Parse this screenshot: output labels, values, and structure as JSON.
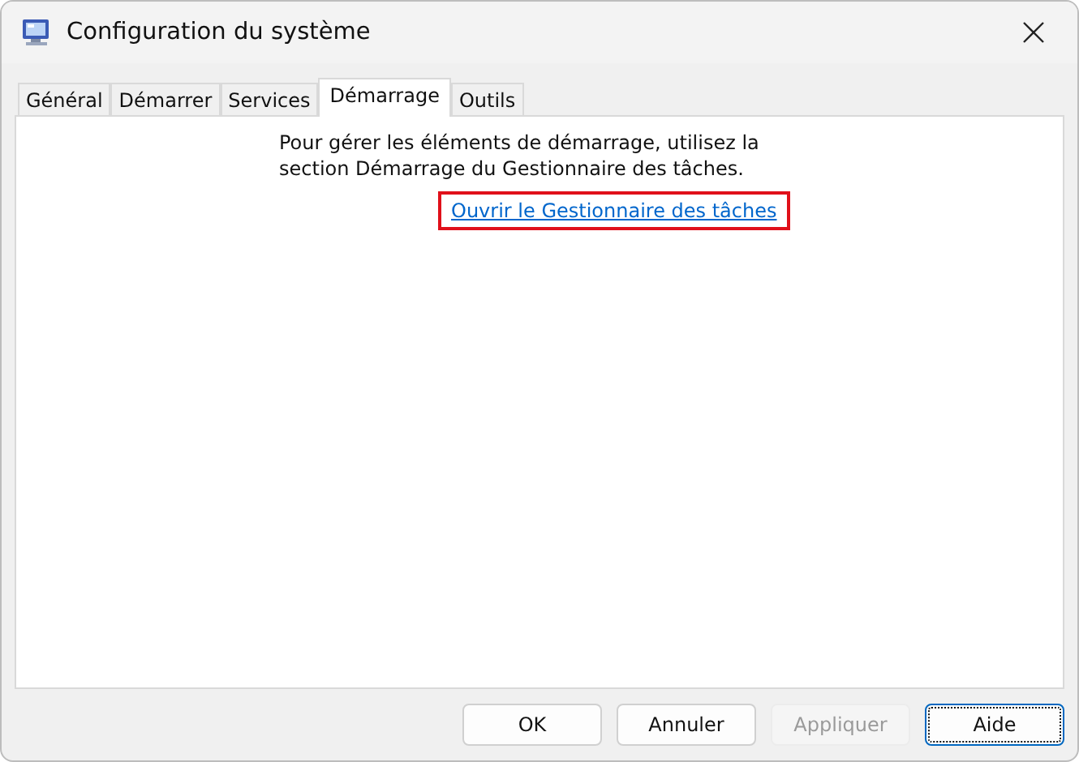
{
  "window": {
    "title": "Configuration du système"
  },
  "tabs": [
    {
      "label": "Général",
      "selected": false
    },
    {
      "label": "Démarrer",
      "selected": false
    },
    {
      "label": "Services",
      "selected": false
    },
    {
      "label": "Démarrage",
      "selected": true
    },
    {
      "label": "Outils",
      "selected": false
    }
  ],
  "panel": {
    "message": "Pour gérer les éléments de démarrage, utilisez la section Démarrage du Gestionnaire des tâches.",
    "link": {
      "label": "Ouvrir le Gestionnaire des tâches",
      "highlighted": true
    }
  },
  "buttons": [
    {
      "label": "OK",
      "disabled": false,
      "focused": false
    },
    {
      "label": "Annuler",
      "disabled": false,
      "focused": false
    },
    {
      "label": "Appliquer",
      "disabled": true,
      "focused": false
    },
    {
      "label": "Aide",
      "disabled": false,
      "focused": true
    }
  ]
}
